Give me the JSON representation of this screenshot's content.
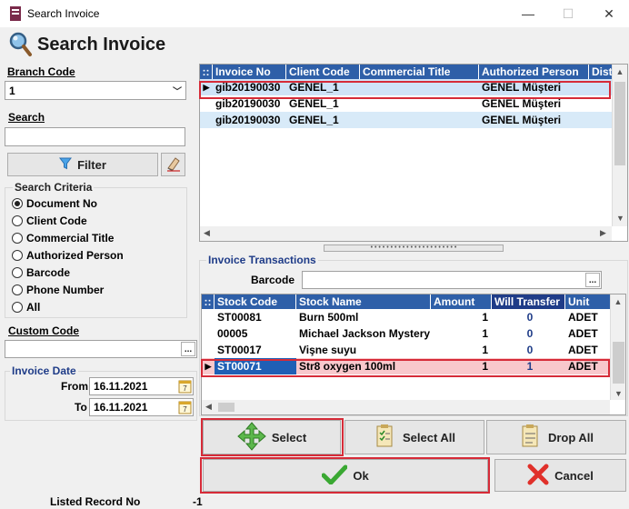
{
  "window": {
    "title": "Search Invoice",
    "minimize": "—",
    "maximize": "☐",
    "close": "✕"
  },
  "header": {
    "title": "Search Invoice"
  },
  "left": {
    "branch_code_label": "Branch Code",
    "branch_code_value": "1",
    "search_label": "Search",
    "search_value": "",
    "filter_label": "Filter",
    "criteria_label": "Search Criteria",
    "criteria": [
      {
        "label": "Document No",
        "selected": true
      },
      {
        "label": "Client Code",
        "selected": false
      },
      {
        "label": "Commercial Title",
        "selected": false
      },
      {
        "label": "Authorized Person",
        "selected": false
      },
      {
        "label": "Barcode",
        "selected": false
      },
      {
        "label": "Phone Number",
        "selected": false
      },
      {
        "label": "All",
        "selected": false
      }
    ],
    "custom_code_label": "Custom Code",
    "custom_code_value": "",
    "invoice_date_label": "Invoice Date",
    "from_label": "From",
    "from_value": "16.11.2021",
    "to_label": "To",
    "to_value": "16.11.2021",
    "listed_label": "Listed Record No",
    "listed_value": "-1"
  },
  "invoices": {
    "columns": [
      "Invoice No",
      "Client Code",
      "Commercial Title",
      "Authorized Person",
      "Dist"
    ],
    "rows": [
      [
        "gib20190030",
        "GENEL_1",
        "",
        "GENEL Müşteri",
        ""
      ],
      [
        "gib20190030",
        "GENEL_1",
        "",
        "GENEL Müşteri",
        ""
      ],
      [
        "gib20190030",
        "GENEL_1",
        "",
        "GENEL Müşteri",
        ""
      ]
    ]
  },
  "transactions": {
    "section_label": "Invoice Transactions",
    "barcode_label": "Barcode",
    "barcode_value": "",
    "columns": [
      "Stock Code",
      "Stock Name",
      "Amount",
      "Will Transfer",
      "Unit"
    ],
    "rows": [
      [
        "ST00081",
        "Burn 500ml",
        "1",
        "0",
        "ADET"
      ],
      [
        "00005",
        "Michael Jackson Mystery",
        "1",
        "0",
        "ADET"
      ],
      [
        "ST00017",
        "Vişne suyu",
        "1",
        "0",
        "ADET"
      ],
      [
        "ST00071",
        "Str8 oxygen 100ml",
        "1",
        "1",
        "ADET"
      ]
    ]
  },
  "buttons": {
    "select": "Select",
    "select_all": "Select All",
    "drop_all": "Drop All",
    "ok": "Ok",
    "cancel": "Cancel",
    "ellipsis": "..."
  },
  "colors": {
    "header_blue": "#2e5fa8",
    "highlight_red": "#d62b38",
    "selected_row": "#cfe3f7",
    "red_row": "#f8c8cc"
  }
}
